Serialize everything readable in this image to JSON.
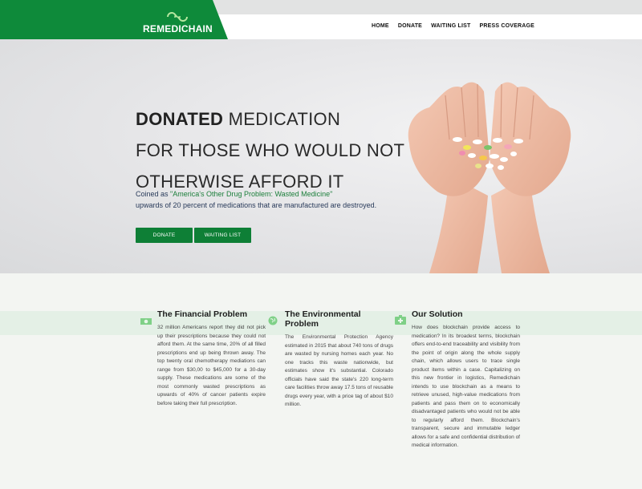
{
  "brand": {
    "name": "REMEDICHAIN",
    "color": "#0e8a3a"
  },
  "nav": {
    "items": [
      "HOME",
      "DONATE",
      "WAITING LIST",
      "PRESS COVERAGE"
    ]
  },
  "hero": {
    "headline_bold": "DONATED",
    "headline_rest_1": " MEDICATION",
    "headline_line2": "FOR THOSE WHO WOULD NOT",
    "headline_line3": "OTHERWISE AFFORD IT",
    "sub_prefix": "Coined as ",
    "sub_quote": "\"America's Other Drug Problem: Wasted Medicine\"",
    "sub_line2": "upwards of 20 percent of medications that are manufactured are destroyed.",
    "button_donate": "DONATE",
    "button_waiting": "WAITING LIST",
    "image": "hands-holding-pills"
  },
  "features": [
    {
      "icon": "money-icon",
      "title": "The Financial Problem",
      "body": "32 million Americans report they did not pick up their prescriptions because they could not afford them. At the same time, 20% of all filled prescriptions end up being thrown away. The top twenty oral chemotherapy mediations can range from $30,00 to $45,000 for a 30-day supply. These medications are some of the most commonly wasted prescriptions as upwards of 40% of cancer patients expire before taking their full prescription."
    },
    {
      "icon": "globe-icon",
      "title": "The Environmental Problem",
      "body": "The Environmental Protection Agency estimated in 2015 that about 740 tons of drugs are wasted by nursing homes each year. No one tracks this waste nationwide, but estimates show it's substantial. Colorado officials have said the state's 220 long-term care facilities throw away 17.5 tons of reusable drugs every year, with a price tag of about $10 million."
    },
    {
      "icon": "medkit-icon",
      "title": "Our Solution",
      "body": "How does blockchain provide access to medication? In its broadest terms, blockchain offers end-to-end traceability and visibility from the point of origin along the whole supply chain, which allows users to trace single product items within a case. Capitalizing on this new frontier in logistics, Remedichain intends to use blockchain as a means to retrieve unused, high-value medications from patients and pass them on to economically disadvantaged patients who would not be able to regularly afford them. Blockchain's transparent, secure and immutable ledger allows for a safe and confidential distribution of medical information."
    }
  ]
}
